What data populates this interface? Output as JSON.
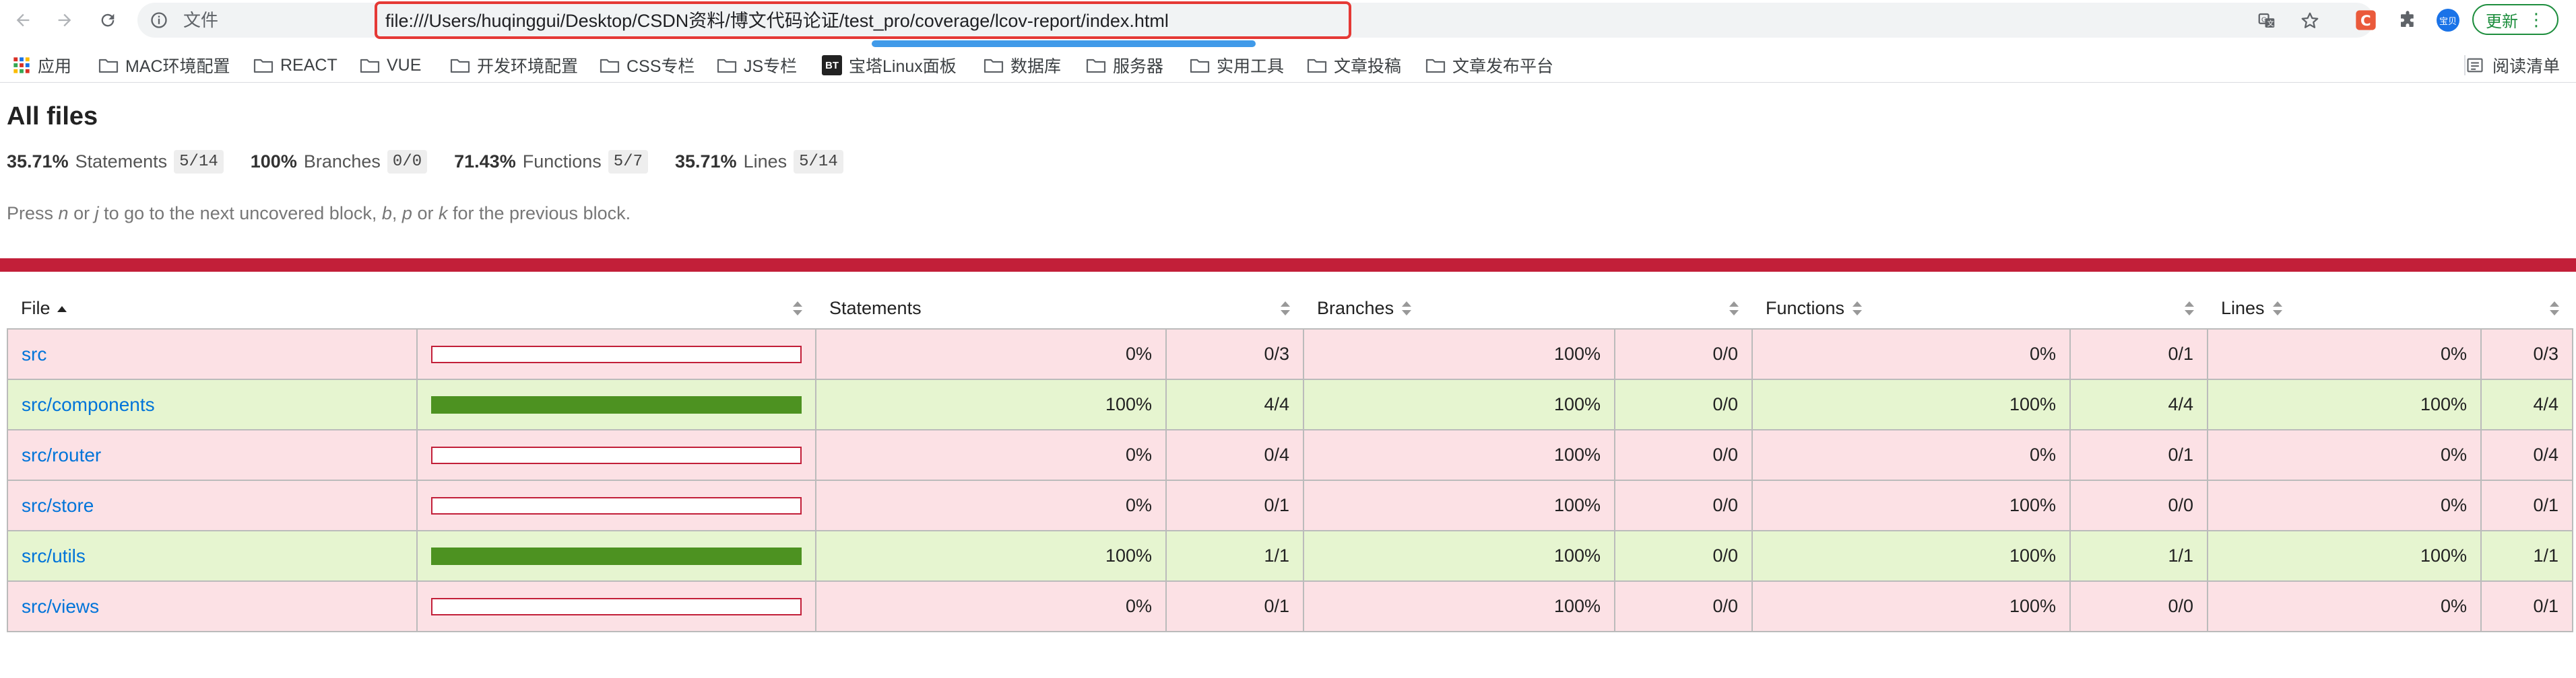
{
  "browser": {
    "omnibox": {
      "scheme_label": "文件",
      "url": "file:///Users/huqinggui/Desktop/CSDN资料/博文代码论证/test_pro/coverage/lcov-report/index.html"
    },
    "profile_initials": "宝贝",
    "update_button": "更新",
    "bookmarks": [
      {
        "label": "应用",
        "icon": "apps-grid-icon"
      },
      {
        "label": "MAC环境配置",
        "icon": "folder-icon"
      },
      {
        "label": "REACT",
        "icon": "folder-icon"
      },
      {
        "label": "VUE",
        "icon": "folder-icon"
      },
      {
        "label": "开发环境配置",
        "icon": "folder-icon"
      },
      {
        "label": "CSS专栏",
        "icon": "folder-icon"
      },
      {
        "label": "JS专栏",
        "icon": "folder-icon"
      },
      {
        "label": "宝塔Linux面板",
        "icon": "bt-favicon",
        "badge": "BT"
      },
      {
        "label": "数据库",
        "icon": "folder-icon"
      },
      {
        "label": "服务器",
        "icon": "folder-icon"
      },
      {
        "label": "实用工具",
        "icon": "folder-icon"
      },
      {
        "label": "文章投稿",
        "icon": "folder-icon"
      },
      {
        "label": "文章发布平台",
        "icon": "folder-icon"
      }
    ],
    "reading_list": "阅读清单"
  },
  "report": {
    "title": "All files",
    "summary": [
      {
        "pct": "35.71%",
        "label": "Statements",
        "fraction": "5/14"
      },
      {
        "pct": "100%",
        "label": "Branches",
        "fraction": "0/0"
      },
      {
        "pct": "71.43%",
        "label": "Functions",
        "fraction": "5/7"
      },
      {
        "pct": "35.71%",
        "label": "Lines",
        "fraction": "5/14"
      }
    ],
    "hint": {
      "t1": "Press ",
      "k1": "n",
      "t2": " or ",
      "k2": "j",
      "t3": " to go to the next uncovered block, ",
      "k3": "b",
      "t4": ", ",
      "k4": "p",
      "t5": " or ",
      "k5": "k",
      "t6": " for the previous block."
    },
    "status_color": "#c21f39",
    "columns": [
      "File",
      "Statements",
      "Branches",
      "Functions",
      "Lines"
    ],
    "rows": [
      {
        "file": "src",
        "status": "low",
        "coverage": 0,
        "statements_pct": "0%",
        "statements": "0/3",
        "branches_pct": "100%",
        "branches": "0/0",
        "functions_pct": "0%",
        "functions": "0/1",
        "lines_pct": "0%",
        "lines": "0/3"
      },
      {
        "file": "src/components",
        "status": "high",
        "coverage": 1,
        "statements_pct": "100%",
        "statements": "4/4",
        "branches_pct": "100%",
        "branches": "0/0",
        "functions_pct": "100%",
        "functions": "4/4",
        "lines_pct": "100%",
        "lines": "4/4"
      },
      {
        "file": "src/router",
        "status": "low",
        "coverage": 0,
        "statements_pct": "0%",
        "statements": "0/4",
        "branches_pct": "100%",
        "branches": "0/0",
        "functions_pct": "0%",
        "functions": "0/1",
        "lines_pct": "0%",
        "lines": "0/4"
      },
      {
        "file": "src/store",
        "status": "low",
        "coverage": 0,
        "statements_pct": "0%",
        "statements": "0/1",
        "branches_pct": "100%",
        "branches": "0/0",
        "functions_pct": "100%",
        "functions": "0/0",
        "lines_pct": "0%",
        "lines": "0/1"
      },
      {
        "file": "src/utils",
        "status": "high",
        "coverage": 1,
        "statements_pct": "100%",
        "statements": "1/1",
        "branches_pct": "100%",
        "branches": "0/0",
        "functions_pct": "100%",
        "functions": "1/1",
        "lines_pct": "100%",
        "lines": "1/1"
      },
      {
        "file": "src/views",
        "status": "low",
        "coverage": 0,
        "statements_pct": "0%",
        "statements": "0/1",
        "branches_pct": "100%",
        "branches": "0/0",
        "functions_pct": "100%",
        "functions": "0/0",
        "lines_pct": "0%",
        "lines": "0/1"
      }
    ]
  }
}
